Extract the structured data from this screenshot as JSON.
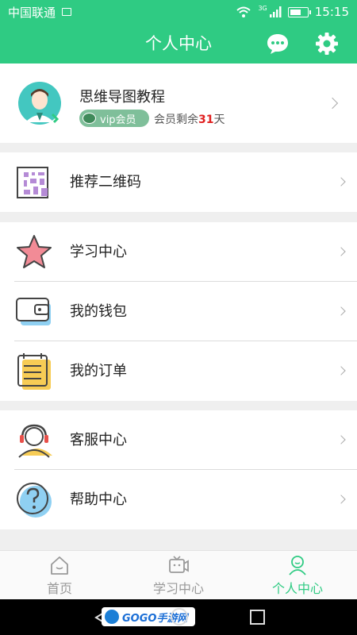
{
  "status_bar": {
    "carrier": "中国联通",
    "network": "3G",
    "time": "15:15",
    "battery_level": 0.7
  },
  "header": {
    "title": "个人中心",
    "icons": [
      "message-icon",
      "gear-icon"
    ]
  },
  "profile": {
    "name": "思维导图教程",
    "vip_badge": "vip会员",
    "remain_prefix": "会员剩余",
    "remain_days": "31",
    "remain_suffix": "天"
  },
  "menu_groups": [
    {
      "items": [
        {
          "label": "推荐二维码",
          "icon": "qrcode-icon"
        }
      ]
    },
    {
      "items": [
        {
          "label": "学习中心",
          "icon": "star-icon"
        },
        {
          "label": "我的钱包",
          "icon": "wallet-icon"
        },
        {
          "label": "我的订单",
          "icon": "order-icon"
        }
      ]
    },
    {
      "items": [
        {
          "label": "客服中心",
          "icon": "customer-service-icon"
        },
        {
          "label": "帮助中心",
          "icon": "help-icon"
        }
      ]
    }
  ],
  "tabs": [
    {
      "label": "首页",
      "icon": "home-icon",
      "active": false
    },
    {
      "label": "学习中心",
      "icon": "study-icon",
      "active": false
    },
    {
      "label": "个人中心",
      "icon": "profile-icon",
      "active": true
    }
  ],
  "colors": {
    "primary": "#2fcb83",
    "accent_red": "#e02020",
    "vip_badge": "#7fbf9a"
  }
}
